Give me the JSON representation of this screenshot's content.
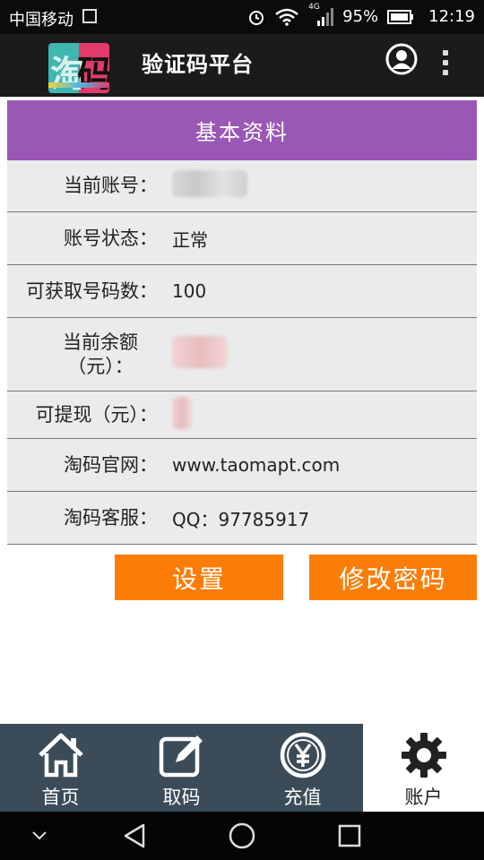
{
  "status_bar": {
    "carrier": "中国移动",
    "network": "4G",
    "battery": "95%",
    "time": "12:19"
  },
  "app_bar": {
    "title": "验证码平台",
    "logo_text": "淘码"
  },
  "panel": {
    "header": "基本资料",
    "rows": [
      {
        "label": "当前账号：",
        "value": ""
      },
      {
        "label": "账号状态：",
        "value": "正常"
      },
      {
        "label": "可获取号码数：",
        "value": "100"
      },
      {
        "label": "当前余额（元）：",
        "value": ""
      },
      {
        "label": "可提现（元）：",
        "value": ""
      },
      {
        "label": "淘码官网：",
        "value": "www.taomapt.com"
      },
      {
        "label": "淘码客服：",
        "value": "QQ：97785917"
      }
    ]
  },
  "buttons": {
    "settings": "设置",
    "change_password": "修改密码"
  },
  "tabs": [
    {
      "label": "首页",
      "icon": "home-icon"
    },
    {
      "label": "取码",
      "icon": "edit-icon"
    },
    {
      "label": "充值",
      "icon": "yen-coin-icon"
    },
    {
      "label": "账户",
      "icon": "gear-icon",
      "active": true
    }
  ],
  "colors": {
    "header_purple": "#9a57b5",
    "button_orange": "#fb7d07",
    "tab_bar": "#3b4c58"
  }
}
